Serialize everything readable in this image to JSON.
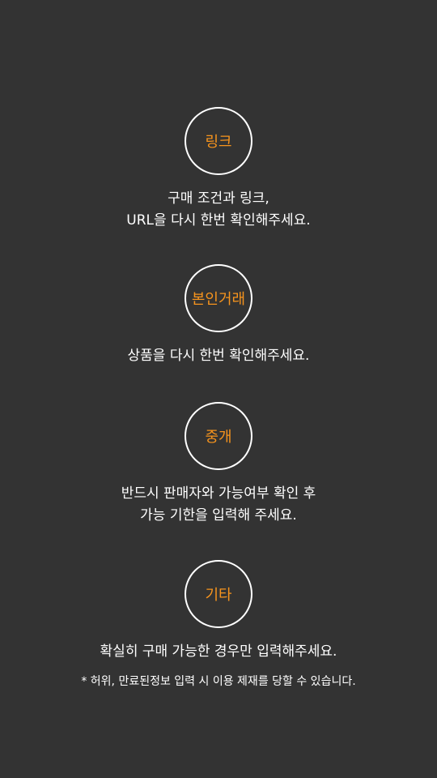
{
  "steps": [
    {
      "label": "링크",
      "lines": [
        "구매 조건과 링크,",
        "URL을 다시 한번 확인해주세요."
      ]
    },
    {
      "label": "본인거래",
      "lines": [
        "상품을 다시 한번 확인해주세요."
      ]
    },
    {
      "label": "중개",
      "lines": [
        "반드시 판매자와 가능여부 확인 후",
        "가능 기한을 입력해 주세요."
      ]
    },
    {
      "label": "기타",
      "lines": [
        "확실히 구매 가능한 경우만 입력해주세요."
      ]
    }
  ],
  "note": "*  허위, 만료된정보 입력 시 이용 제재를 당할 수 있습니다.",
  "colors": {
    "background": "#333333",
    "accent": "#f7941d",
    "text": "#ffffff"
  }
}
